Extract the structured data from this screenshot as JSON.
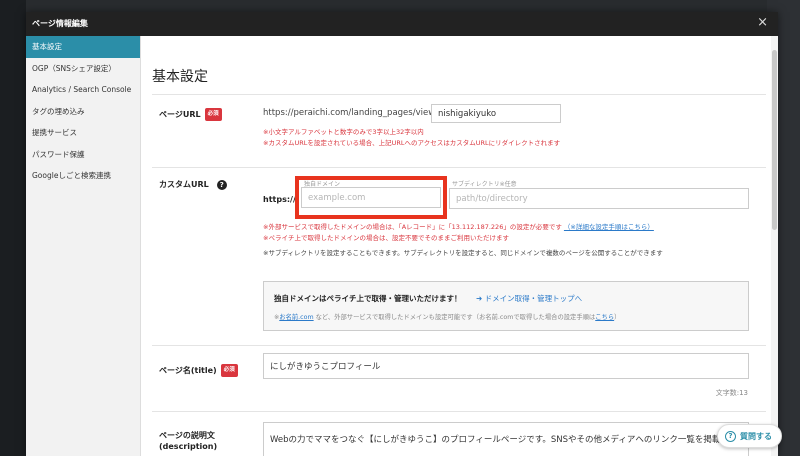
{
  "modal": {
    "title": "ページ情報編集",
    "close_label": "×"
  },
  "nav": {
    "items": [
      {
        "label": "基本設定",
        "active": true
      },
      {
        "label": "OGP（SNSシェア設定）"
      },
      {
        "label": "Analytics / Search Console"
      },
      {
        "label": "タグの埋め込み"
      },
      {
        "label": "提携サービス"
      },
      {
        "label": "パスワード保護"
      },
      {
        "label": "Googleしごと検索連携"
      }
    ]
  },
  "content": {
    "heading": "基本設定",
    "page_url": {
      "label": "ページURL",
      "required": "必須",
      "prefix": "https://peraichi.com/landing_pages/view/",
      "value": "nishigakiyuko",
      "note1": "※小文字アルファベットと数字のみで3字以上32字以内",
      "note2": "※カスタムURLを設定されている場合、上記URLへのアクセスはカスタムURLにリダイレクトされます"
    },
    "custom_url": {
      "label": "カスタムURL",
      "help": "?",
      "prefix": "https://",
      "domain_label": "独自ドメイン",
      "domain_placeholder": "example.com",
      "subdir_label": "サブディレクトリ※任意",
      "subdir_placeholder": "path/to/directory",
      "note1_a": "※外部サービスで取得したドメインの場合は、「Aレコード」に「13.112.187.226」の設定が必要です",
      "note1_link": "（※詳細な設定手順はこちら）",
      "note2": "※ペライチ上で取得したドメインの場合は、設定不要でそのままご利用いただけます",
      "note3": "※サブディレクトリを設定することもできます。サブディレクトリを設定すると、同じドメインで複数のページを公開することができます",
      "info_title": "独自ドメインはペライチ上で取得・管理いただけます！",
      "info_link": "➜ ドメイン取得・管理トップへ",
      "info_sub_prefix": "※",
      "info_sub_link1": "お名前.com",
      "info_sub_mid": " など、外部サービスで取得したドメインも設定可能です（お名前.comで取得した場合の設定手順は",
      "info_sub_link2": "こちら",
      "info_sub_end": "）"
    },
    "page_title": {
      "label": "ページ名(title)",
      "required": "必須",
      "value": "にしがきゆうこプロフィール",
      "char_count": "文字数:13"
    },
    "description": {
      "label_line1": "ページの説明文",
      "label_line2": "(description)",
      "value": "Webの力でママをつなぐ【にしがきゆうこ】のプロフィールページです。SNSやその他メディアへのリンク一覧を掲載していま"
    }
  },
  "help_button": {
    "label": "質問する",
    "icon": "?"
  },
  "colors": {
    "accent": "#2b8ea8",
    "required": "#d9363e",
    "highlight": "#e8331e",
    "header": "#222222"
  }
}
